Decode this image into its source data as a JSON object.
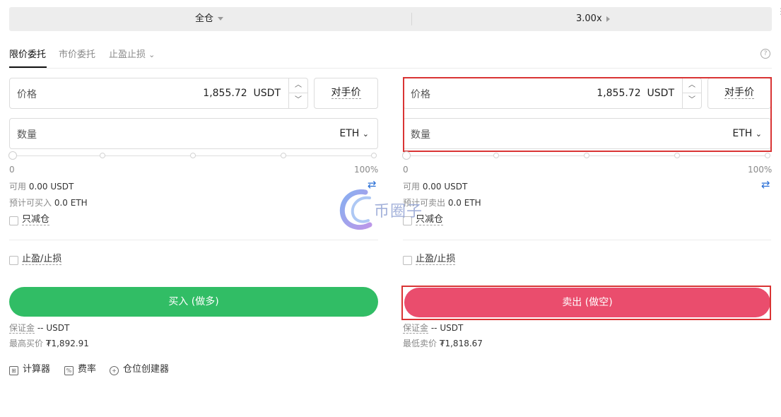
{
  "header": {
    "margin_mode": "全仓",
    "leverage": "3.00x"
  },
  "tabs": [
    {
      "label": "限价委托",
      "active": true
    },
    {
      "label": "市价委托",
      "active": false
    },
    {
      "label": "止盈止损",
      "active": false
    }
  ],
  "buy": {
    "price_label": "价格",
    "price_value": "1,855.72",
    "price_unit": "USDT",
    "counterparty_label": "对手价",
    "qty_label": "数量",
    "qty_unit": "ETH",
    "slider_min": "0",
    "slider_max": "100%",
    "slider_value_fraction": 0,
    "available_label": "可用",
    "available_value": "0.00 USDT",
    "estimate_label": "预计可买入",
    "estimate_value": "0.0 ETH",
    "reduce_only_label": "只减仓",
    "tpsl_label": "止盈/止损",
    "button_label": "买入 (做多)",
    "margin_label": "保证金",
    "margin_value": "-- USDT",
    "limit_label": "最高买价",
    "limit_value": "₮1,892.91"
  },
  "sell": {
    "price_label": "价格",
    "price_value": "1,855.72",
    "price_unit": "USDT",
    "counterparty_label": "对手价",
    "qty_label": "数量",
    "qty_unit": "ETH",
    "slider_min": "0",
    "slider_max": "100%",
    "slider_value_fraction": 0,
    "available_label": "可用",
    "available_value": "0.00 USDT",
    "estimate_label": "预计可卖出",
    "estimate_value": "0.0 ETH",
    "reduce_only_label": "只减仓",
    "tpsl_label": "止盈/止损",
    "button_label": "卖出 (做空)",
    "margin_label": "保证金",
    "margin_value": "-- USDT",
    "limit_label": "最低卖价",
    "limit_value": "₮1,818.67"
  },
  "footer": {
    "calculator": "计算器",
    "fee_rate": "费率",
    "position_builder": "仓位创建器"
  },
  "watermark": {
    "text": "币圈子"
  },
  "colors": {
    "buy": "#31bd65",
    "sell": "#ea4d6d",
    "highlight_box": "#d93434",
    "link_blue": "#2a6fd6"
  }
}
